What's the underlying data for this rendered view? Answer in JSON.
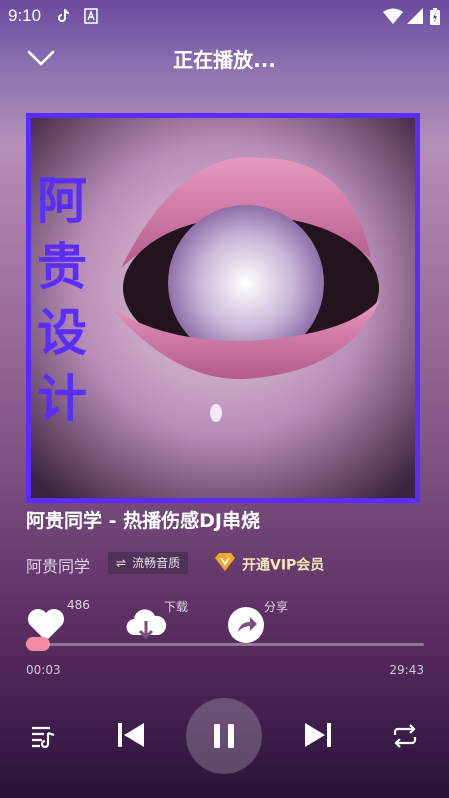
{
  "status": {
    "time": "9:10"
  },
  "header": {
    "title": "正在播放..."
  },
  "cover": {
    "text": "阿贵设计"
  },
  "song": {
    "title": "阿贵同学 - 热播伤感DJ串烧",
    "artist": "阿贵同学",
    "quality": "流畅音质",
    "vip": "开通VIP会员"
  },
  "actions": {
    "like_count": "486",
    "download": "下载",
    "share": "分享"
  },
  "progress": {
    "current": "00:03",
    "total": "29:43",
    "fraction": 0.002
  },
  "colors": {
    "accent": "#f28ba4",
    "frame": "#5b2dfa",
    "vip_gold": "#f5a623"
  }
}
